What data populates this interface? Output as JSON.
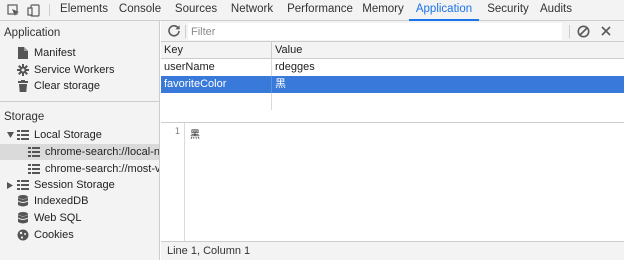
{
  "tabs": [
    {
      "label": "Elements"
    },
    {
      "label": "Console"
    },
    {
      "label": "Sources"
    },
    {
      "label": "Network"
    },
    {
      "label": "Performance"
    },
    {
      "label": "Memory"
    },
    {
      "label": "Application"
    },
    {
      "label": "Security"
    },
    {
      "label": "Audits"
    }
  ],
  "active_tab": "Application",
  "sidebar": {
    "application_heading": "Application",
    "application_items": [
      {
        "label": "Manifest",
        "icon": "document-icon"
      },
      {
        "label": "Service Workers",
        "icon": "gear-icon"
      },
      {
        "label": "Clear storage",
        "icon": "trash-icon"
      }
    ],
    "storage_heading": "Storage",
    "local_storage": {
      "label": "Local Storage",
      "children": [
        {
          "label": "chrome-search://local-ntp"
        },
        {
          "label": "chrome-search://most-visited"
        }
      ]
    },
    "session_storage": "Session Storage",
    "indexeddb": "IndexedDB",
    "websql": "Web SQL",
    "cookies": "Cookies"
  },
  "toolbar": {
    "filter_placeholder": "Filter"
  },
  "table": {
    "columns": [
      "Key",
      "Value"
    ],
    "rows": [
      {
        "key": "userName",
        "value": "rdegges"
      },
      {
        "key": "favoriteColor",
        "value": "黑"
      }
    ]
  },
  "preview": {
    "line_number": "1",
    "line_text": "黑"
  },
  "status": "Line 1, Column 1",
  "colors": {
    "accent": "#1a73e8",
    "selection": "#3879d9"
  }
}
